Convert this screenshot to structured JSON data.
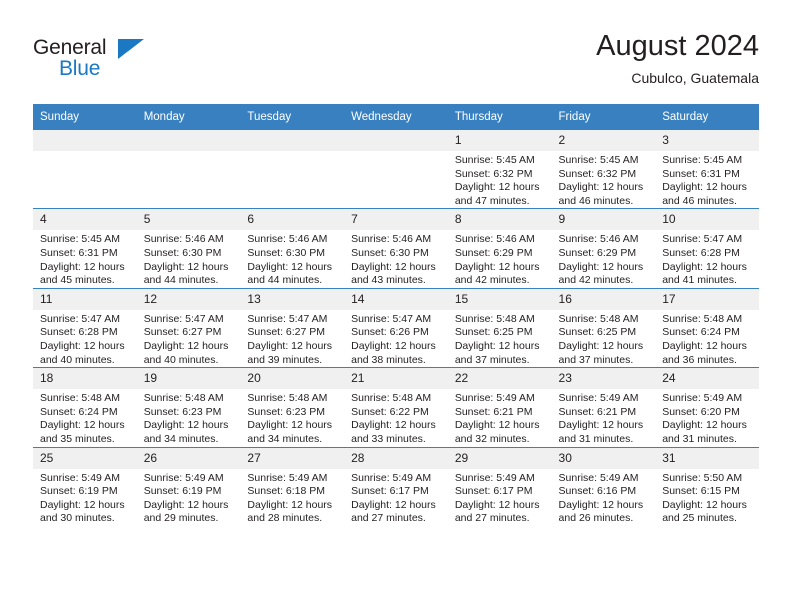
{
  "brand": {
    "name_part1": "General",
    "name_part2": "Blue",
    "triangle_icon": "brand-triangle-icon",
    "accent_color": "#1b79c3"
  },
  "header": {
    "title": "August 2024",
    "subtitle": "Cubulco, Guatemala"
  },
  "theme": {
    "header_row_bg": "#3880c0",
    "daynum_bg": "#f0f0f0",
    "text_color": "#231f20"
  },
  "weekdays": [
    "Sunday",
    "Monday",
    "Tuesday",
    "Wednesday",
    "Thursday",
    "Friday",
    "Saturday"
  ],
  "weeks": [
    [
      {
        "day": "",
        "empty": true,
        "sunrise": "",
        "sunset": "",
        "daylight_line1": "",
        "daylight_line2": ""
      },
      {
        "day": "",
        "empty": true,
        "sunrise": "",
        "sunset": "",
        "daylight_line1": "",
        "daylight_line2": ""
      },
      {
        "day": "",
        "empty": true,
        "sunrise": "",
        "sunset": "",
        "daylight_line1": "",
        "daylight_line2": ""
      },
      {
        "day": "",
        "empty": true,
        "sunrise": "",
        "sunset": "",
        "daylight_line1": "",
        "daylight_line2": ""
      },
      {
        "day": "1",
        "empty": false,
        "sunrise": "Sunrise: 5:45 AM",
        "sunset": "Sunset: 6:32 PM",
        "daylight_line1": "Daylight: 12 hours",
        "daylight_line2": "and 47 minutes."
      },
      {
        "day": "2",
        "empty": false,
        "sunrise": "Sunrise: 5:45 AM",
        "sunset": "Sunset: 6:32 PM",
        "daylight_line1": "Daylight: 12 hours",
        "daylight_line2": "and 46 minutes."
      },
      {
        "day": "3",
        "empty": false,
        "sunrise": "Sunrise: 5:45 AM",
        "sunset": "Sunset: 6:31 PM",
        "daylight_line1": "Daylight: 12 hours",
        "daylight_line2": "and 46 minutes."
      }
    ],
    [
      {
        "day": "4",
        "empty": false,
        "sunrise": "Sunrise: 5:45 AM",
        "sunset": "Sunset: 6:31 PM",
        "daylight_line1": "Daylight: 12 hours",
        "daylight_line2": "and 45 minutes."
      },
      {
        "day": "5",
        "empty": false,
        "sunrise": "Sunrise: 5:46 AM",
        "sunset": "Sunset: 6:30 PM",
        "daylight_line1": "Daylight: 12 hours",
        "daylight_line2": "and 44 minutes."
      },
      {
        "day": "6",
        "empty": false,
        "sunrise": "Sunrise: 5:46 AM",
        "sunset": "Sunset: 6:30 PM",
        "daylight_line1": "Daylight: 12 hours",
        "daylight_line2": "and 44 minutes."
      },
      {
        "day": "7",
        "empty": false,
        "sunrise": "Sunrise: 5:46 AM",
        "sunset": "Sunset: 6:30 PM",
        "daylight_line1": "Daylight: 12 hours",
        "daylight_line2": "and 43 minutes."
      },
      {
        "day": "8",
        "empty": false,
        "sunrise": "Sunrise: 5:46 AM",
        "sunset": "Sunset: 6:29 PM",
        "daylight_line1": "Daylight: 12 hours",
        "daylight_line2": "and 42 minutes."
      },
      {
        "day": "9",
        "empty": false,
        "sunrise": "Sunrise: 5:46 AM",
        "sunset": "Sunset: 6:29 PM",
        "daylight_line1": "Daylight: 12 hours",
        "daylight_line2": "and 42 minutes."
      },
      {
        "day": "10",
        "empty": false,
        "sunrise": "Sunrise: 5:47 AM",
        "sunset": "Sunset: 6:28 PM",
        "daylight_line1": "Daylight: 12 hours",
        "daylight_line2": "and 41 minutes."
      }
    ],
    [
      {
        "day": "11",
        "empty": false,
        "sunrise": "Sunrise: 5:47 AM",
        "sunset": "Sunset: 6:28 PM",
        "daylight_line1": "Daylight: 12 hours",
        "daylight_line2": "and 40 minutes."
      },
      {
        "day": "12",
        "empty": false,
        "sunrise": "Sunrise: 5:47 AM",
        "sunset": "Sunset: 6:27 PM",
        "daylight_line1": "Daylight: 12 hours",
        "daylight_line2": "and 40 minutes."
      },
      {
        "day": "13",
        "empty": false,
        "sunrise": "Sunrise: 5:47 AM",
        "sunset": "Sunset: 6:27 PM",
        "daylight_line1": "Daylight: 12 hours",
        "daylight_line2": "and 39 minutes."
      },
      {
        "day": "14",
        "empty": false,
        "sunrise": "Sunrise: 5:47 AM",
        "sunset": "Sunset: 6:26 PM",
        "daylight_line1": "Daylight: 12 hours",
        "daylight_line2": "and 38 minutes."
      },
      {
        "day": "15",
        "empty": false,
        "sunrise": "Sunrise: 5:48 AM",
        "sunset": "Sunset: 6:25 PM",
        "daylight_line1": "Daylight: 12 hours",
        "daylight_line2": "and 37 minutes."
      },
      {
        "day": "16",
        "empty": false,
        "sunrise": "Sunrise: 5:48 AM",
        "sunset": "Sunset: 6:25 PM",
        "daylight_line1": "Daylight: 12 hours",
        "daylight_line2": "and 37 minutes."
      },
      {
        "day": "17",
        "empty": false,
        "sunrise": "Sunrise: 5:48 AM",
        "sunset": "Sunset: 6:24 PM",
        "daylight_line1": "Daylight: 12 hours",
        "daylight_line2": "and 36 minutes."
      }
    ],
    [
      {
        "day": "18",
        "empty": false,
        "sunrise": "Sunrise: 5:48 AM",
        "sunset": "Sunset: 6:24 PM",
        "daylight_line1": "Daylight: 12 hours",
        "daylight_line2": "and 35 minutes."
      },
      {
        "day": "19",
        "empty": false,
        "sunrise": "Sunrise: 5:48 AM",
        "sunset": "Sunset: 6:23 PM",
        "daylight_line1": "Daylight: 12 hours",
        "daylight_line2": "and 34 minutes."
      },
      {
        "day": "20",
        "empty": false,
        "sunrise": "Sunrise: 5:48 AM",
        "sunset": "Sunset: 6:23 PM",
        "daylight_line1": "Daylight: 12 hours",
        "daylight_line2": "and 34 minutes."
      },
      {
        "day": "21",
        "empty": false,
        "sunrise": "Sunrise: 5:48 AM",
        "sunset": "Sunset: 6:22 PM",
        "daylight_line1": "Daylight: 12 hours",
        "daylight_line2": "and 33 minutes."
      },
      {
        "day": "22",
        "empty": false,
        "sunrise": "Sunrise: 5:49 AM",
        "sunset": "Sunset: 6:21 PM",
        "daylight_line1": "Daylight: 12 hours",
        "daylight_line2": "and 32 minutes."
      },
      {
        "day": "23",
        "empty": false,
        "sunrise": "Sunrise: 5:49 AM",
        "sunset": "Sunset: 6:21 PM",
        "daylight_line1": "Daylight: 12 hours",
        "daylight_line2": "and 31 minutes."
      },
      {
        "day": "24",
        "empty": false,
        "sunrise": "Sunrise: 5:49 AM",
        "sunset": "Sunset: 6:20 PM",
        "daylight_line1": "Daylight: 12 hours",
        "daylight_line2": "and 31 minutes."
      }
    ],
    [
      {
        "day": "25",
        "empty": false,
        "sunrise": "Sunrise: 5:49 AM",
        "sunset": "Sunset: 6:19 PM",
        "daylight_line1": "Daylight: 12 hours",
        "daylight_line2": "and 30 minutes."
      },
      {
        "day": "26",
        "empty": false,
        "sunrise": "Sunrise: 5:49 AM",
        "sunset": "Sunset: 6:19 PM",
        "daylight_line1": "Daylight: 12 hours",
        "daylight_line2": "and 29 minutes."
      },
      {
        "day": "27",
        "empty": false,
        "sunrise": "Sunrise: 5:49 AM",
        "sunset": "Sunset: 6:18 PM",
        "daylight_line1": "Daylight: 12 hours",
        "daylight_line2": "and 28 minutes."
      },
      {
        "day": "28",
        "empty": false,
        "sunrise": "Sunrise: 5:49 AM",
        "sunset": "Sunset: 6:17 PM",
        "daylight_line1": "Daylight: 12 hours",
        "daylight_line2": "and 27 minutes."
      },
      {
        "day": "29",
        "empty": false,
        "sunrise": "Sunrise: 5:49 AM",
        "sunset": "Sunset: 6:17 PM",
        "daylight_line1": "Daylight: 12 hours",
        "daylight_line2": "and 27 minutes."
      },
      {
        "day": "30",
        "empty": false,
        "sunrise": "Sunrise: 5:49 AM",
        "sunset": "Sunset: 6:16 PM",
        "daylight_line1": "Daylight: 12 hours",
        "daylight_line2": "and 26 minutes."
      },
      {
        "day": "31",
        "empty": false,
        "sunrise": "Sunrise: 5:50 AM",
        "sunset": "Sunset: 6:15 PM",
        "daylight_line1": "Daylight: 12 hours",
        "daylight_line2": "and 25 minutes."
      }
    ]
  ]
}
